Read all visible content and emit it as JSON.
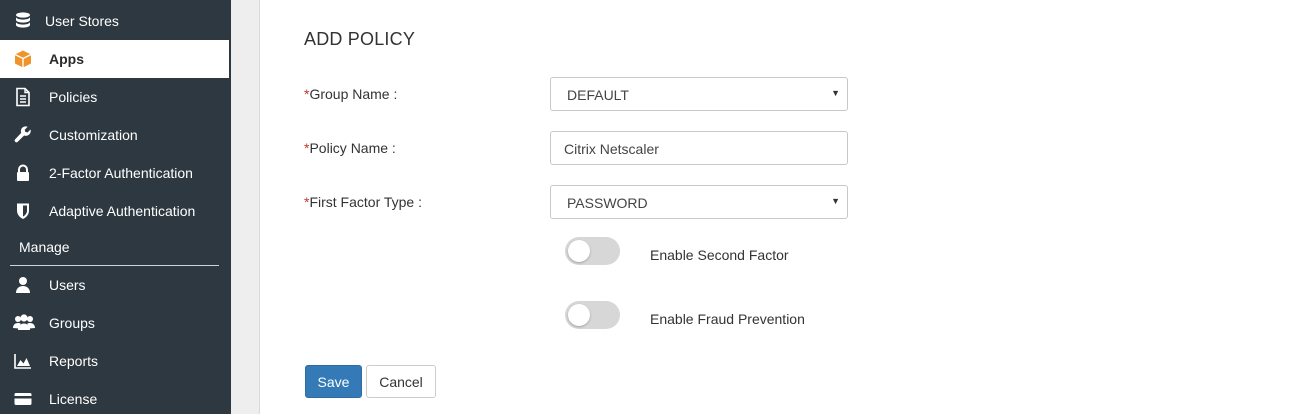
{
  "sidebar": {
    "items": [
      {
        "label": "User Stores",
        "icon": "database-icon"
      },
      {
        "label": "Apps",
        "icon": "cube-icon",
        "active": true
      },
      {
        "label": "Policies",
        "icon": "document-icon"
      },
      {
        "label": "Customization",
        "icon": "wrench-icon"
      },
      {
        "label": "2-Factor Authentication",
        "icon": "lock-icon"
      },
      {
        "label": "Adaptive Authentication",
        "icon": "shield-icon"
      }
    ],
    "section_label": "Manage",
    "manage_items": [
      {
        "label": "Users",
        "icon": "user-icon"
      },
      {
        "label": "Groups",
        "icon": "users-icon"
      },
      {
        "label": "Reports",
        "icon": "area-chart-icon"
      },
      {
        "label": "License",
        "icon": "credit-card-icon"
      }
    ]
  },
  "form": {
    "title": "ADD POLICY",
    "required_mark": "*",
    "group_name": {
      "label": "Group Name :",
      "value": "DEFAULT"
    },
    "policy_name": {
      "label": "Policy Name :",
      "value": "Citrix Netscaler"
    },
    "first_factor_type": {
      "label": "First Factor Type :",
      "value": "PASSWORD"
    },
    "enable_second_factor": {
      "label": "Enable Second Factor",
      "enabled": false
    },
    "enable_fraud_prevention": {
      "label": "Enable Fraud Prevention",
      "enabled": false
    },
    "save_label": "Save",
    "cancel_label": "Cancel"
  },
  "colors": {
    "sidebar_bg": "#2e3840",
    "accent_orange": "#f0932b",
    "primary_button": "#337ab7",
    "required_red": "#c0392b"
  }
}
